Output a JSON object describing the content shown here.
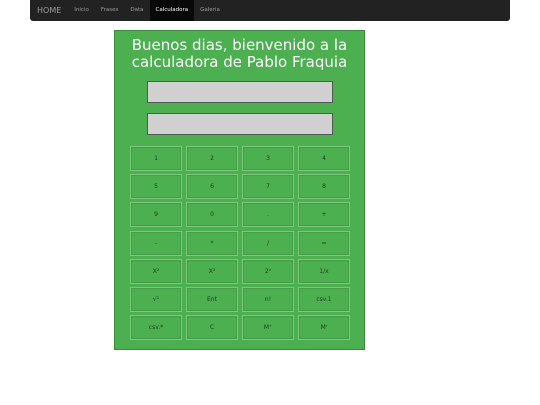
{
  "nav": {
    "brand": "HOME",
    "items": [
      "Inicio",
      "Frases",
      "Data",
      "Calculadora",
      "Galeria"
    ],
    "active": "Calculadora"
  },
  "calculator": {
    "title_line1": "Buenos dias, bienvenido a la",
    "title_line2": "calculadora de Pablo Fraquia",
    "display1": "",
    "display2": "",
    "keys": [
      [
        "1",
        "2",
        "3",
        "4"
      ],
      [
        "5",
        "6",
        "7",
        "8"
      ],
      [
        "9",
        "0",
        ".",
        "+"
      ],
      [
        "-",
        "*",
        "/",
        "="
      ],
      [
        "X²",
        "X³",
        "2ⁿ",
        "1/x"
      ],
      [
        "√¹",
        "Ent",
        "n!",
        "csv.1"
      ],
      [
        "csv.*",
        "C",
        "M⁺",
        "Mʳ"
      ]
    ]
  },
  "colors": {
    "panel": "#4caf50",
    "navbar": "#222222"
  }
}
